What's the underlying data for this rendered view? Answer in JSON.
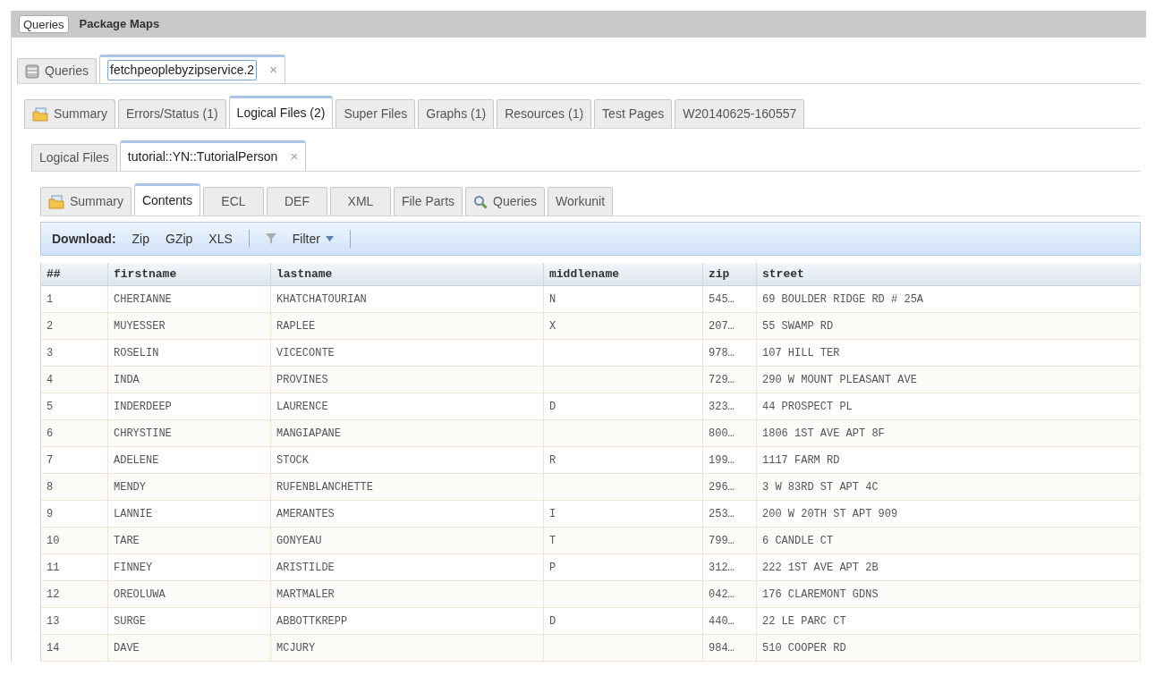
{
  "top_tabs": [
    {
      "label": "Queries",
      "selected": true
    },
    {
      "label": "Package Maps",
      "selected": false
    }
  ],
  "query_tabs": [
    {
      "label": "Queries",
      "kind": "database",
      "selected": false
    },
    {
      "label": "fetchpeoplebyzipservice.2",
      "selected": true,
      "close": "×"
    }
  ],
  "workunit_tabs": [
    {
      "label": "Summary",
      "kind": "folder",
      "selected": false
    },
    {
      "label": "Errors/Status (1)",
      "selected": false
    },
    {
      "label": "Logical Files (2)",
      "selected": true
    },
    {
      "label": "Super Files",
      "selected": false
    },
    {
      "label": "Graphs (1)",
      "selected": false
    },
    {
      "label": "Resources (1)",
      "selected": false
    },
    {
      "label": "Test Pages",
      "selected": false
    },
    {
      "label": "W20140625-160557",
      "selected": false
    }
  ],
  "file_tabs": [
    {
      "label": "Logical Files",
      "selected": false
    },
    {
      "label": "tutorial::YN::TutorialPerson",
      "selected": true,
      "close": "×"
    }
  ],
  "detail_tabs": [
    {
      "label": "Summary",
      "kind": "folder",
      "selected": false
    },
    {
      "label": "Contents",
      "selected": true
    },
    {
      "label": "ECL",
      "selected": false
    },
    {
      "label": "DEF",
      "selected": false
    },
    {
      "label": "XML",
      "selected": false
    },
    {
      "label": "File Parts",
      "selected": false
    },
    {
      "label": "Queries",
      "kind": "search",
      "selected": false
    },
    {
      "label": "Workunit",
      "selected": false
    }
  ],
  "toolbar": {
    "label": "Download:",
    "buttons": [
      "Zip",
      "GZip",
      "XLS"
    ],
    "filter": "Filter"
  },
  "table": {
    "columns": [
      "##",
      "firstname",
      "lastname",
      "middlename",
      "zip",
      "street"
    ],
    "rows": [
      [
        "1",
        "CHERIANNE",
        "KHATCHATOURIAN",
        "N",
        "545…",
        "69 BOULDER RIDGE RD # 25A"
      ],
      [
        "2",
        "MUYESSER",
        "RAPLEE",
        "X",
        "207…",
        "55 SWAMP RD"
      ],
      [
        "3",
        "ROSELIN",
        "VICECONTE",
        "",
        "978…",
        "107 HILL TER"
      ],
      [
        "4",
        "INDA",
        "PROVINES",
        "",
        "729…",
        "290 W MOUNT PLEASANT AVE"
      ],
      [
        "5",
        "INDERDEEP",
        "LAURENCE",
        "D",
        "323…",
        "44 PROSPECT PL"
      ],
      [
        "6",
        "CHRYSTINE",
        "MANGIAPANE",
        "",
        "800…",
        "1806 1ST AVE APT 8F"
      ],
      [
        "7",
        "ADELENE",
        "STOCK",
        "R",
        "199…",
        "1117 FARM RD"
      ],
      [
        "8",
        "MENDY",
        "RUFENBLANCHETTE",
        "",
        "296…",
        "3 W 83RD ST APT 4C"
      ],
      [
        "9",
        "LANNIE",
        "AMERANTES",
        "I",
        "253…",
        "200 W 20TH ST APT 909"
      ],
      [
        "10",
        "TARE",
        "GONYEAU",
        "T",
        "799…",
        "6 CANDLE CT"
      ],
      [
        "11",
        "FINNEY",
        "ARISTILDE",
        "P",
        "312…",
        "222 1ST AVE APT 2B"
      ],
      [
        "12",
        "OREOLUWA",
        "MARTMALER",
        "",
        "042…",
        "176 CLAREMONT GDNS"
      ],
      [
        "13",
        "SURGE",
        "ABBOTTKREPP",
        "D",
        "440…",
        "22 LE PARC CT"
      ],
      [
        "14",
        "DAVE",
        "MCJURY",
        "",
        "984…",
        "510 COOPER RD"
      ]
    ]
  }
}
